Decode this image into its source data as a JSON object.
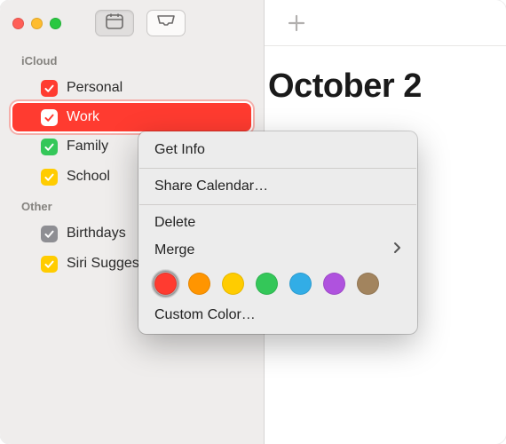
{
  "toolbar": {
    "icons": {
      "calendar": "calendar-icon",
      "inbox": "inbox-icon"
    }
  },
  "sidebar": {
    "sections": [
      {
        "title": "iCloud",
        "items": [
          {
            "label": "Personal",
            "color": "#ff3b30",
            "checked": true,
            "selected": false
          },
          {
            "label": "Work",
            "color": "#ff3b30",
            "checked": true,
            "selected": true
          },
          {
            "label": "Family",
            "color": "#34c759",
            "checked": true,
            "selected": false
          },
          {
            "label": "School",
            "color": "#ffcc00",
            "checked": true,
            "selected": false
          }
        ]
      },
      {
        "title": "Other",
        "items": [
          {
            "label": "Birthdays",
            "color": "#8e8e93",
            "checked": true,
            "selected": false
          },
          {
            "label": "Siri Suggestions",
            "color": "#ffcc00",
            "checked": true,
            "selected": false
          }
        ]
      }
    ]
  },
  "main": {
    "month_title": "October 2",
    "add_icon": "plus-icon"
  },
  "context_menu": {
    "items": [
      {
        "label": "Get Info",
        "type": "item"
      },
      {
        "type": "separator"
      },
      {
        "label": "Share Calendar…",
        "type": "item"
      },
      {
        "type": "separator"
      },
      {
        "label": "Delete",
        "type": "item"
      },
      {
        "label": "Merge",
        "type": "submenu"
      },
      {
        "type": "swatches"
      },
      {
        "label": "Custom Color…",
        "type": "item"
      }
    ],
    "swatches": [
      {
        "color": "#ff3b30",
        "selected": true
      },
      {
        "color": "#ff9500",
        "selected": false
      },
      {
        "color": "#ffcc00",
        "selected": false
      },
      {
        "color": "#34c759",
        "selected": false
      },
      {
        "color": "#32ade6",
        "selected": false
      },
      {
        "color": "#af52de",
        "selected": false
      },
      {
        "color": "#a2845e",
        "selected": false
      }
    ]
  }
}
